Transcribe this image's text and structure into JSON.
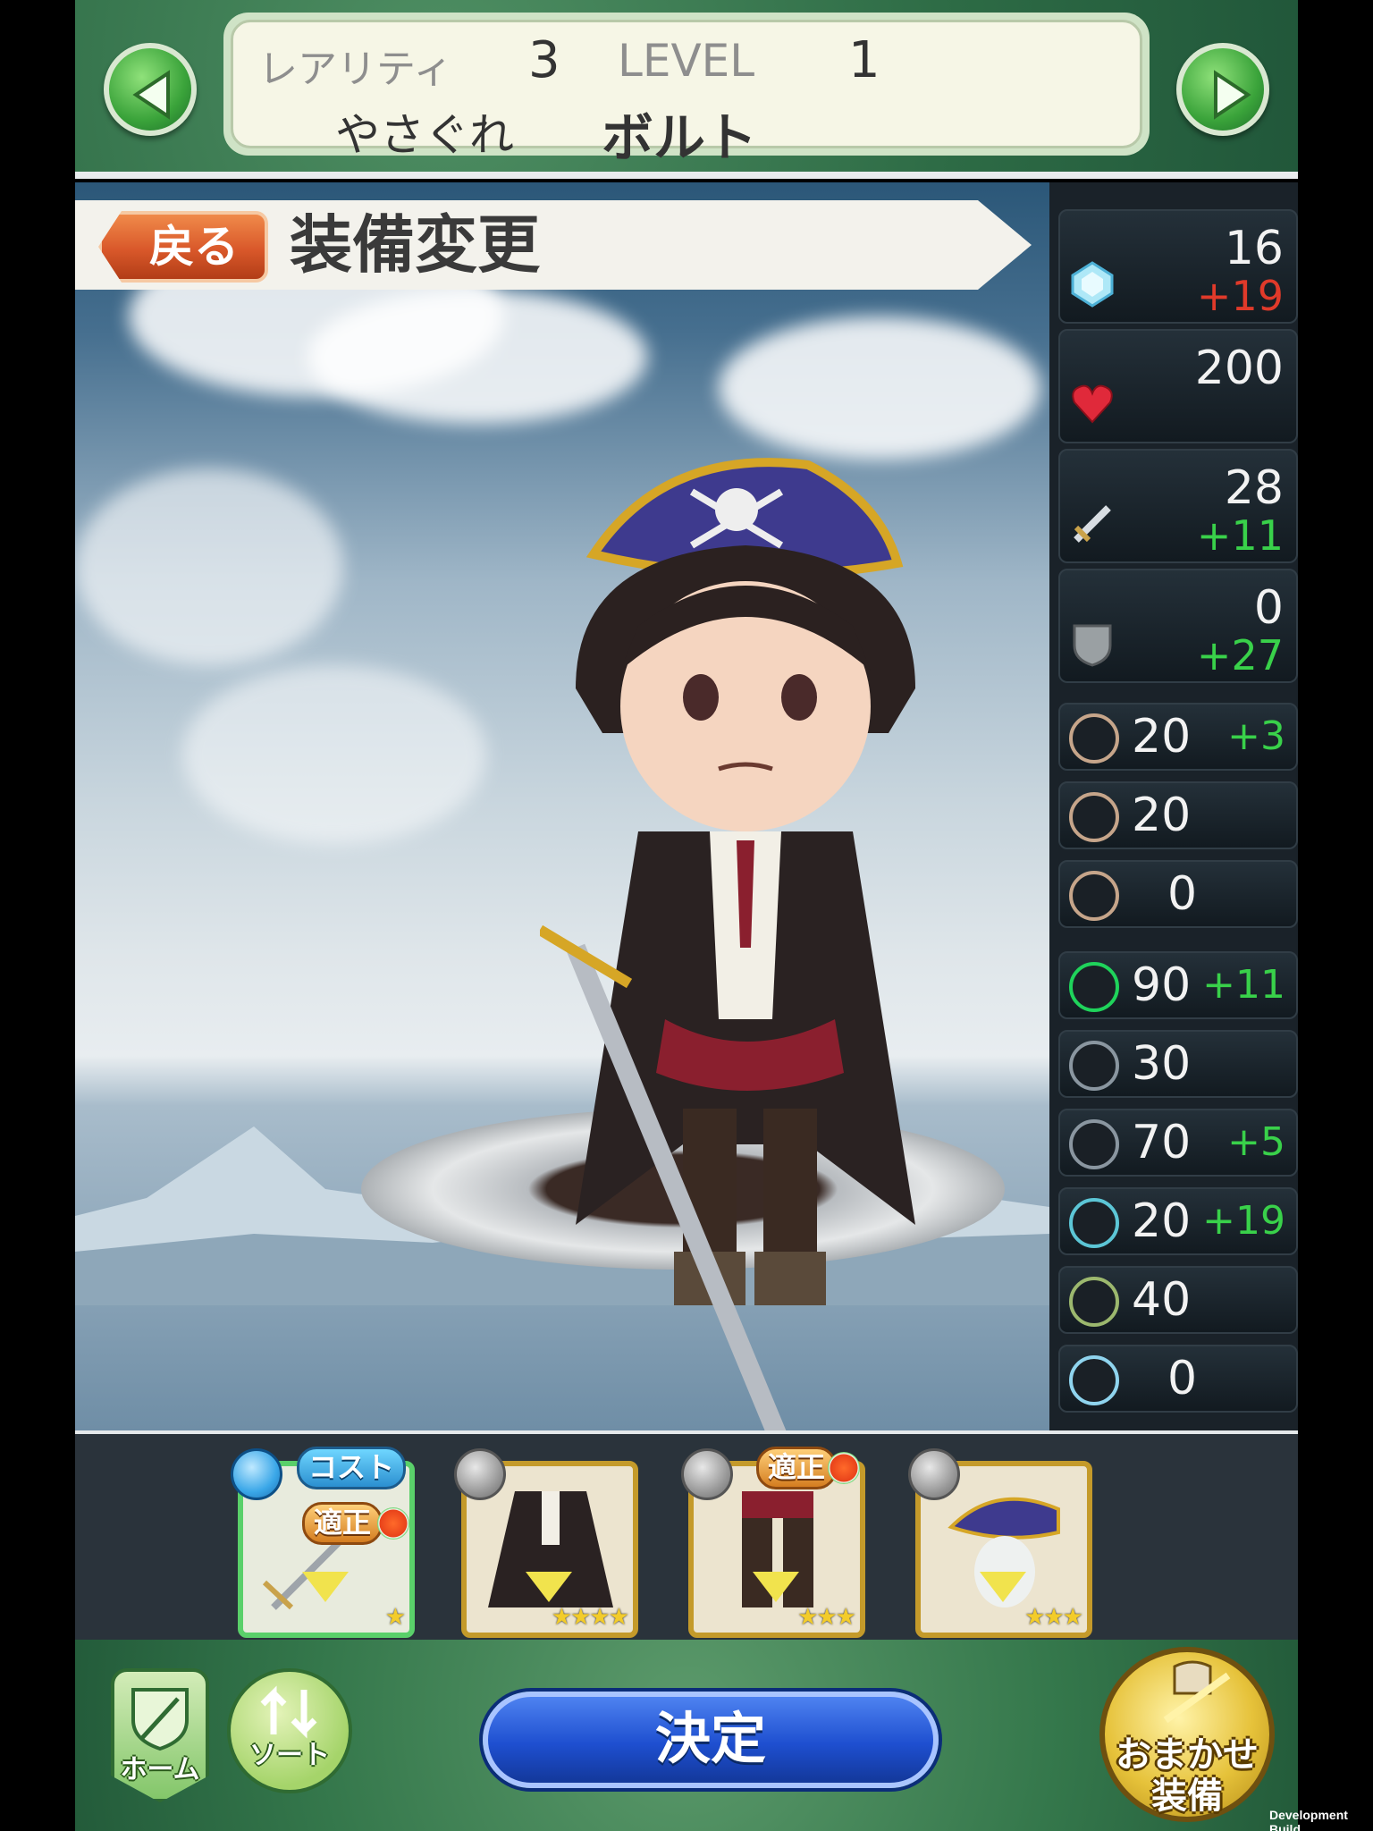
{
  "header": {
    "rarity_label": "レアリティ",
    "rarity_value": "3",
    "level_label": "LEVEL",
    "level_value": "1",
    "char_title": "やさぐれ",
    "char_name": "ボルト"
  },
  "screen": {
    "back_label": "戻る",
    "title": "装備変更"
  },
  "stats": {
    "crystal": {
      "icon": "crystal-icon",
      "value": "16",
      "bonus": "+19"
    },
    "hp": {
      "icon": "heart-icon",
      "value": "200",
      "bonus": ""
    },
    "attack": {
      "icon": "sword-icon",
      "value": "28",
      "bonus": "+11"
    },
    "defense": {
      "icon": "shield-icon",
      "value": "0",
      "bonus": "+27"
    },
    "slash": {
      "icon": "slash-resist-icon",
      "value": "20",
      "bonus": "+3"
    },
    "bow": {
      "icon": "bow-resist-icon",
      "value": "20",
      "bonus": ""
    },
    "magic": {
      "icon": "magic-resist-icon",
      "value": "0",
      "bonus": ""
    },
    "earth": {
      "icon": "earth-element-icon",
      "value": "90",
      "bonus": "+11"
    },
    "tri": {
      "icon": "triforce-element-icon",
      "value": "30",
      "bonus": ""
    },
    "dots": {
      "icon": "dots-element-icon",
      "value": "70",
      "bonus": "+5"
    },
    "water": {
      "icon": "water-element-icon",
      "value": "20",
      "bonus": "+19"
    },
    "wind": {
      "icon": "wind-element-icon",
      "value": "40",
      "bonus": ""
    },
    "cloud": {
      "icon": "cloud-element-icon",
      "value": "0",
      "bonus": ""
    }
  },
  "equipment": {
    "cost_tag": "コスト",
    "fit_tag": "適正",
    "slots": [
      {
        "name": "sword",
        "stars": "★"
      },
      {
        "name": "coat",
        "stars": "★★★★"
      },
      {
        "name": "boots",
        "stars": "★★★"
      },
      {
        "name": "hat",
        "stars": "★★★"
      }
    ]
  },
  "footer": {
    "home_label": "ホーム",
    "sort_label": "ソート",
    "confirm_label": "決定",
    "auto_label_1": "おまかせ",
    "auto_label_2": "装備"
  },
  "dev_label": "Development Build",
  "colors": {
    "bonus_up": "#39d14a",
    "bonus_crystal": "#e03a2a",
    "confirm": "#1e4fd0",
    "frame_green": "#2d6b45"
  }
}
